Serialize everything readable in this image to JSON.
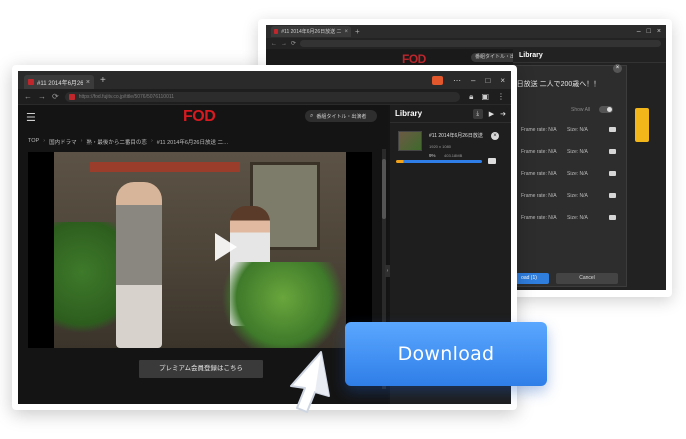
{
  "back_window": {
    "tab_title": "#11 2014年6月26日放送 二人で",
    "logo": "FOD",
    "search_placeholder": "番組タイトル・出演者",
    "panel_title": "Library",
    "dialog": {
      "title": "126日放送 二人で200歳へ！！",
      "link": "...",
      "show_all": "Show All",
      "rows": [
        {
          "frame": "Frame rate: N/A",
          "size": "Size: N/A"
        },
        {
          "frame": "Frame rate: N/A",
          "size": "Size: N/A"
        },
        {
          "frame": "Frame rate: N/A",
          "size": "Size: N/A"
        },
        {
          "frame": "Frame rate: N/A",
          "size": "Size: N/A"
        },
        {
          "frame": "Frame rate: N/A",
          "size": "Size: N/A"
        }
      ],
      "download_label": "oad (1)",
      "cancel_label": "Cancel"
    }
  },
  "front_window": {
    "tab_title": "#11 2014年6月26日",
    "url": "https://fod.fujitv.co.jp/title/5076/5076110011",
    "logo": "FOD",
    "search_placeholder": "番組タイトル・出演者",
    "breadcrumb": [
      "TOP",
      "国内ドラマ",
      "熟・最後から二番目の恋",
      "#11 2014年6月26日放送 二…"
    ],
    "premium_button": "プレミアム会員登録はこちら",
    "library": {
      "title": "Library",
      "item": {
        "title": "#11 2014年6月26日放送",
        "resolution": "1920 x 1080",
        "percent": "9%",
        "size": "403.18MB",
        "progress": 0.09
      }
    }
  },
  "download_button": {
    "label": "Download"
  },
  "colors": {
    "brand_red": "#d71920",
    "accent_blue": "#2f7ee8",
    "progress_orange": "#f2a31a"
  },
  "icons": [
    "hamburger-icon",
    "search-icon",
    "play-icon",
    "download-icon",
    "close-icon",
    "cursor-icon"
  ]
}
